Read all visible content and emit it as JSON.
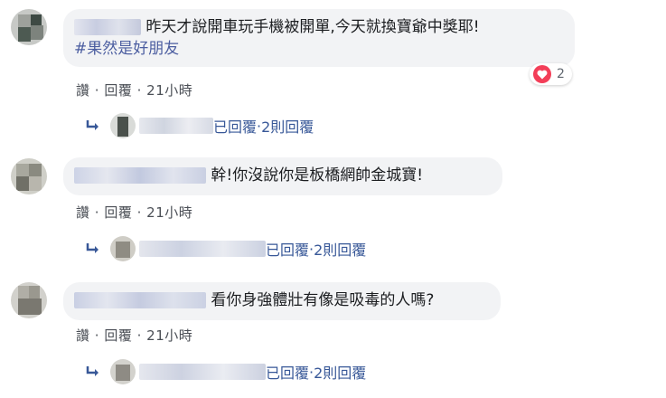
{
  "comments": [
    {
      "text": "昨天才說開車玩手機被開單,今天就換寶爺中獎耶!",
      "hashtag": "#果然是好朋友",
      "reaction_count": "2",
      "actions": {
        "like": "讚",
        "reply": "回覆",
        "time": "21小時"
      },
      "replies": {
        "replied_label": "已回覆",
        "count_label": "2則回覆"
      }
    },
    {
      "text": "幹!你沒說你是板橋網帥金城寶!",
      "actions": {
        "like": "讚",
        "reply": "回覆",
        "time": "21小時"
      },
      "replies": {
        "replied_label": "已回覆",
        "count_label": "2則回覆"
      }
    },
    {
      "text": "看你身強體壯有像是吸毒的人嗎?",
      "actions": {
        "like": "讚",
        "reply": "回覆",
        "time": "21小時"
      },
      "replies": {
        "replied_label": "已回覆",
        "count_label": "2則回覆"
      }
    }
  ],
  "separator": " · ",
  "colors": {
    "bubble": "#f2f3f5",
    "link": "#385898",
    "hashtag": "#4b5da0",
    "heart": "#f33e58"
  }
}
